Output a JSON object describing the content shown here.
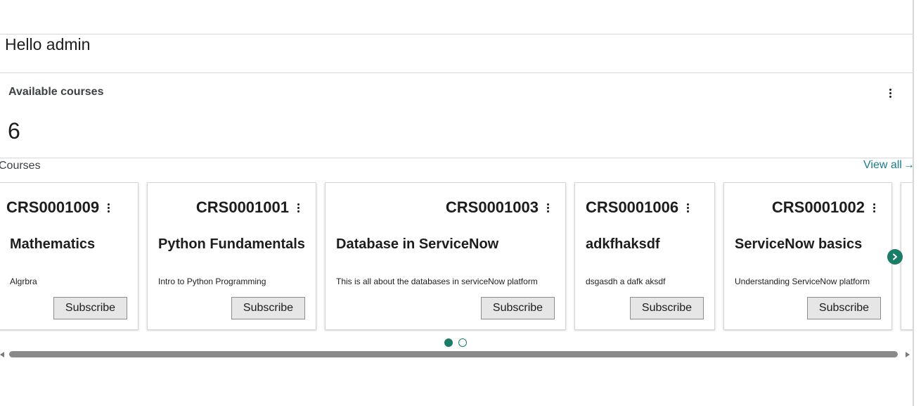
{
  "greeting": "Hello admin",
  "available_courses": {
    "title": "Available courses",
    "count": "6"
  },
  "courses_section": {
    "label": "Courses",
    "view_all": "View all",
    "view_all_arrow": "→"
  },
  "cards": [
    {
      "number": "CRS0001009",
      "title": "Mathematics",
      "description": "Algrbra",
      "button": "Subscribe"
    },
    {
      "number": "CRS0001001",
      "title": "Python Fundamentals",
      "description": "Intro to Python Programming",
      "button": "Subscribe"
    },
    {
      "number": "CRS0001003",
      "title": "Database in ServiceNow",
      "description": "This is all about the databases in serviceNow platform",
      "button": "Subscribe"
    },
    {
      "number": "CRS0001006",
      "title": "adkfhaksdf",
      "description": "dsgasdh a dafk aksdf",
      "button": "Subscribe"
    },
    {
      "number": "CRS0001002",
      "title": "ServiceNow basics",
      "description": "Understanding ServiceNow platform",
      "button": "Subscribe"
    }
  ],
  "pagination": {
    "total_pages": 2,
    "active_page": 1
  },
  "colors": {
    "accent": "#1a7d68",
    "link": "#1a7a8c"
  },
  "icons": {
    "more": "more-vertical-icon",
    "next": "chevron-right-icon",
    "arrow": "arrow-right-icon"
  }
}
